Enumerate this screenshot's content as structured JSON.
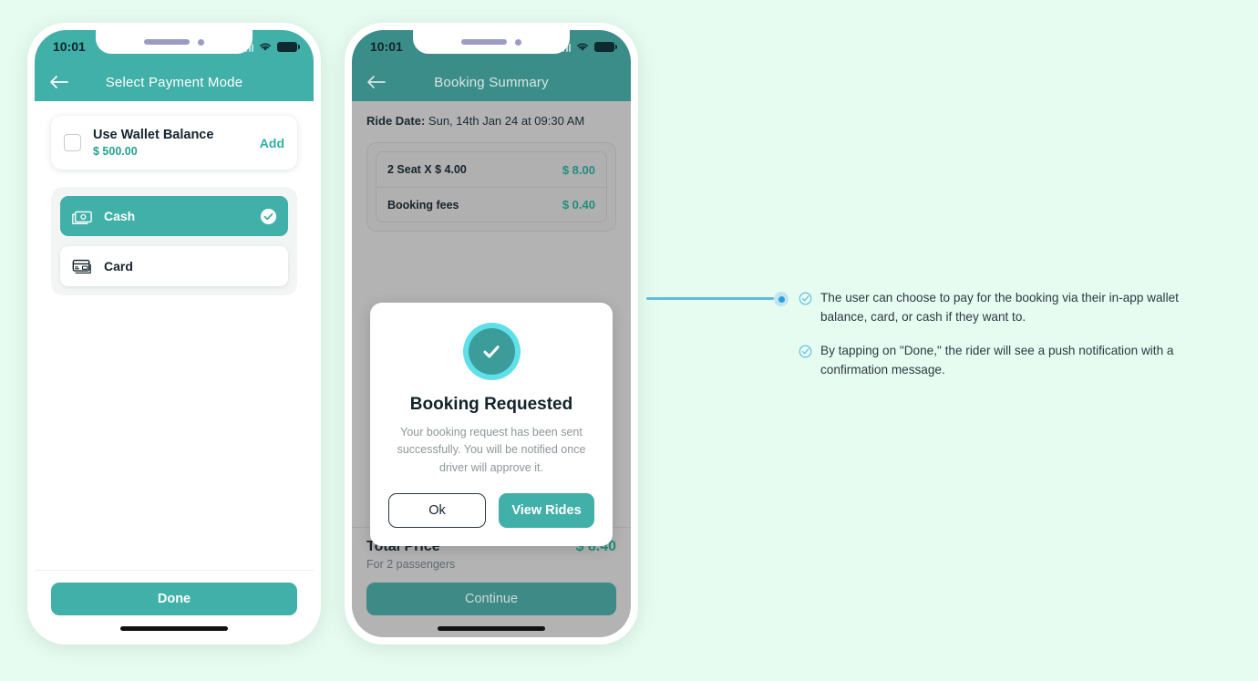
{
  "phone1": {
    "status": {
      "time": "10:01",
      "signal_icon": "signal-bars-icon",
      "wifi_icon": "wifi-icon",
      "battery_icon": "battery-icon"
    },
    "appbar": {
      "title": "Select Payment Mode",
      "back_icon": "back-arrow-icon"
    },
    "wallet": {
      "title": "Use Wallet Balance",
      "amount": "$ 500.00",
      "add_label": "Add",
      "checkbox_icon": "checkbox-unchecked-icon"
    },
    "payment_methods": [
      {
        "label": "Cash",
        "icon": "cash-banknote-icon",
        "selected": true,
        "check_icon": "check-circle-icon"
      },
      {
        "label": "Card",
        "icon": "credit-card-icon",
        "selected": false
      }
    ],
    "footer": {
      "done_label": "Done"
    }
  },
  "phone2": {
    "status": {
      "time": "10:01",
      "signal_icon": "signal-bars-icon",
      "wifi_icon": "wifi-icon",
      "battery_icon": "battery-icon"
    },
    "appbar": {
      "title": "Booking Summary",
      "back_icon": "back-arrow-icon"
    },
    "ride_date_label": "Ride Date:",
    "ride_date_value": "Sun, 14th Jan 24 at 09:30 AM",
    "fare_rows": [
      {
        "label": "2 Seat X $ 4.00",
        "amount": "$ 8.00"
      },
      {
        "label": "Booking fees",
        "amount": "$ 0.40"
      }
    ],
    "footer": {
      "total_label": "Total Price",
      "total_amount": "$ 8.40",
      "total_sub": "For 2 passengers",
      "continue_label": "Continue"
    },
    "modal": {
      "success_icon": "success-check-circle-icon",
      "title": "Booking Requested",
      "description": "Your booking request has been sent successfully. You will be notified once driver will approve it.",
      "ok_label": "Ok",
      "view_rides_label": "View Rides"
    }
  },
  "annotations": {
    "items": [
      {
        "icon": "check-circle-outline-icon",
        "text": "The user can choose to pay for the booking via their in-app wallet balance, card, or cash if they want to."
      },
      {
        "icon": "check-circle-outline-icon",
        "text": "By tapping on \"Done,\" the rider will see a push notification with a confirmation message."
      }
    ]
  },
  "colors": {
    "page_background": "#e7fcf0",
    "teal_primary": "#40b0a8",
    "teal_dim": "#3b8d89",
    "accent_green": "#23a38f",
    "connector_blue": "#62b9dd",
    "success_ring": "#5fe0e8"
  }
}
